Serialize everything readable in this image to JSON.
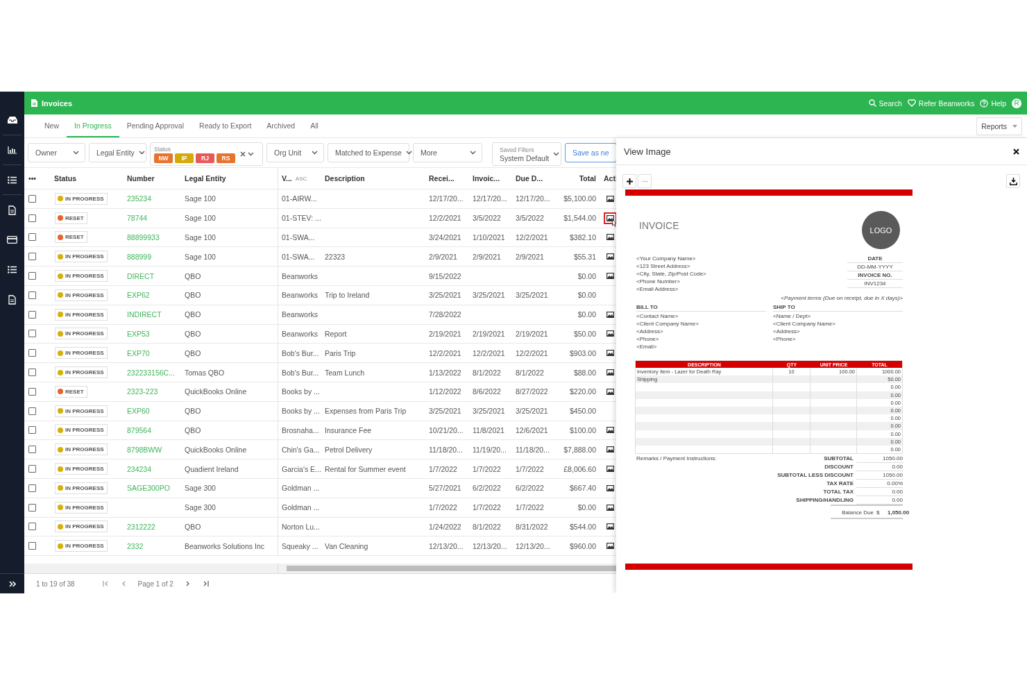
{
  "header": {
    "title": "Invoices",
    "links": [
      {
        "kind": "search",
        "label": "Search"
      },
      {
        "kind": "heart",
        "label": "Refer Beanworks"
      },
      {
        "kind": "help",
        "label": "Help"
      }
    ],
    "avatar": "R"
  },
  "tabs": [
    {
      "label": "New",
      "selected": false
    },
    {
      "label": "In Progress",
      "selected": true
    },
    {
      "label": "Pending Approval",
      "selected": false
    },
    {
      "label": "Ready to Export",
      "selected": false
    },
    {
      "label": "Archived",
      "selected": false
    },
    {
      "label": "All",
      "selected": false
    }
  ],
  "reports_button": "Reports",
  "filters": {
    "owner": "Owner",
    "legal_entity": "Legal Entity",
    "status_label": "Status",
    "status_chips": [
      {
        "label": "NW",
        "color": "#e8742c"
      },
      {
        "label": "IP",
        "color": "#d6a90a"
      },
      {
        "label": "RJ",
        "color": "#e85a5a"
      },
      {
        "label": "RS",
        "color": "#e8742c"
      }
    ],
    "org_unit": "Org Unit",
    "matched": "Matched to Expense",
    "more": "More",
    "saved_label": "Saved Filters",
    "saved_value": "System Default",
    "save_button": "Save as ne"
  },
  "table": {
    "columns": [
      "•••",
      "Status",
      "Number",
      "Legal Entity",
      "V...",
      "Description",
      "Recei...",
      "Invoic...",
      "Due D...",
      "Total",
      "Acti"
    ],
    "sort": "ASC",
    "rows": [
      {
        "checked": false,
        "status": "IN PROGRESS",
        "color": "#d6b00a",
        "number": "235234",
        "legal_entity": "Sage 100",
        "vendor": "01-AIRW...",
        "received": "12/17/20...",
        "invoice_date": "12/17/20...",
        "due_date": "12/17/20...",
        "total": "$5,100.00",
        "image": true,
        "image_focused": false
      },
      {
        "checked": false,
        "status": "RESET",
        "color": "#e8642c",
        "number": "78744",
        "legal_entity": "Sage 100",
        "vendor": "01-STEV: ...",
        "received": "12/2/2021",
        "invoice_date": "3/5/2022",
        "due_date": "3/5/2022",
        "total": "$1,544.00",
        "image": true,
        "image_focused": true
      },
      {
        "checked": false,
        "status": "RESET",
        "color": "#e8642c",
        "number": "88899933",
        "legal_entity": "Sage 100",
        "vendor": "01-SWA...",
        "received": "3/24/2021",
        "invoice_date": "1/10/2021",
        "due_date": "12/2/2021",
        "total": "$382.10",
        "image": true,
        "image_focused": false
      },
      {
        "checked": false,
        "status": "IN PROGRESS",
        "color": "#d6b00a",
        "number": "888999",
        "legal_entity": "Sage 100",
        "vendor": "01-SWA...",
        "description": "22323",
        "received": "2/9/2021",
        "invoice_date": "2/9/2021",
        "due_date": "2/9/2021",
        "total": "$55.31",
        "image": true,
        "image_focused": false
      },
      {
        "checked": false,
        "status": "IN PROGRESS",
        "color": "#d6b00a",
        "number": "DIRECT",
        "legal_entity": "QBO",
        "vendor": "Beanworks",
        "received": "9/15/2022",
        "total": "$0.00",
        "image": true,
        "image_focused": false
      },
      {
        "checked": false,
        "status": "IN PROGRESS",
        "color": "#d6b00a",
        "number": "EXP62",
        "legal_entity": "QBO",
        "vendor": "Beanworks",
        "description": "Trip to Ireland",
        "received": "3/25/2021",
        "invoice_date": "3/25/2021",
        "due_date": "3/25/2021",
        "total": "$0.00",
        "image": false
      },
      {
        "checked": false,
        "status": "IN PROGRESS",
        "color": "#d6b00a",
        "number": "INDIRECT",
        "legal_entity": "QBO",
        "vendor": "Beanworks",
        "received": "7/28/2022",
        "total": "$0.00",
        "image": true,
        "image_focused": false
      },
      {
        "checked": false,
        "status": "IN PROGRESS",
        "color": "#d6b00a",
        "number": "EXP53",
        "legal_entity": "QBO",
        "vendor": "Beanworks",
        "description": "Report",
        "received": "2/19/2021",
        "invoice_date": "2/19/2021",
        "due_date": "2/19/2021",
        "total": "$50.00",
        "image": true,
        "image_focused": false
      },
      {
        "checked": false,
        "status": "IN PROGRESS",
        "color": "#d6b00a",
        "number": "EXP70",
        "legal_entity": "QBO",
        "vendor": "Bob's Bur...",
        "description": "Paris Trip",
        "received": "12/2/2021",
        "invoice_date": "12/2/2021",
        "due_date": "12/2/2021",
        "total": "$903.00",
        "image": true,
        "image_focused": false
      },
      {
        "checked": false,
        "status": "IN PROGRESS",
        "color": "#d6b00a",
        "number": "232233156C...",
        "legal_entity": "Tomas QBO",
        "vendor": "Bob's Bur...",
        "description": "Team Lunch",
        "received": "1/13/2022",
        "invoice_date": "8/1/2022",
        "due_date": "8/1/2022",
        "total": "$88.00",
        "image": true,
        "image_focused": false
      },
      {
        "checked": false,
        "status": "RESET",
        "color": "#e8642c",
        "number": "2323-223",
        "legal_entity": "QuickBooks Online",
        "vendor": "Books by ...",
        "received": "1/12/2022",
        "invoice_date": "8/6/2022",
        "due_date": "8/27/2022",
        "total": "$220.00",
        "image": true,
        "image_focused": false
      },
      {
        "checked": false,
        "status": "IN PROGRESS",
        "color": "#d6b00a",
        "number": "EXP60",
        "legal_entity": "QBO",
        "vendor": "Books by ...",
        "description": "Expenses from Paris Trip",
        "received": "3/25/2021",
        "invoice_date": "3/25/2021",
        "due_date": "3/25/2021",
        "total": "$450.00",
        "image": false
      },
      {
        "checked": false,
        "status": "IN PROGRESS",
        "color": "#d6b00a",
        "number": "879564",
        "legal_entity": "QBO",
        "vendor": "Brosnaha...",
        "description": "Insurance Fee",
        "received": "10/21/20...",
        "invoice_date": "11/8/2021",
        "due_date": "12/6/2021",
        "total": "$100.00",
        "image": true,
        "image_focused": false
      },
      {
        "checked": false,
        "status": "IN PROGRESS",
        "color": "#d6b00a",
        "number": "8798BWW",
        "legal_entity": "QuickBooks Online",
        "vendor": "Chin's Ga...",
        "description": "Petrol Delivery",
        "received": "11/18/20...",
        "invoice_date": "11/19/20...",
        "due_date": "11/18/20...",
        "total": "$7,888.00",
        "image": true,
        "image_focused": false
      },
      {
        "checked": false,
        "status": "IN PROGRESS",
        "color": "#d6b00a",
        "number": "234234",
        "legal_entity": "Quadient Ireland",
        "vendor": "Garcia's E...",
        "description": "Rental for Summer event",
        "received": "1/7/2022",
        "invoice_date": "1/7/2022",
        "due_date": "1/7/2022",
        "total": "£8,006.60",
        "image": true,
        "image_focused": false
      },
      {
        "checked": false,
        "status": "IN PROGRESS",
        "color": "#d6b00a",
        "number": "SAGE300PO",
        "legal_entity": "Sage 300",
        "vendor": "Goldman ...",
        "received": "5/27/2021",
        "invoice_date": "6/2/2022",
        "due_date": "6/2/2022",
        "total": "$667.40",
        "image": true,
        "image_focused": false
      },
      {
        "checked": false,
        "status": "IN PROGRESS",
        "color": "#d6b00a",
        "legal_entity": "Sage 300",
        "vendor": "Goldman ...",
        "received": "1/7/2022",
        "invoice_date": "1/7/2022",
        "due_date": "1/7/2022",
        "total": "$0.00",
        "image": true,
        "image_focused": false
      },
      {
        "checked": false,
        "status": "IN PROGRESS",
        "color": "#d6b00a",
        "number": "2312222",
        "legal_entity": "QBO",
        "vendor": "Norton Lu...",
        "received": "1/24/2022",
        "invoice_date": "8/1/2022",
        "due_date": "8/31/2022",
        "total": "$544.00",
        "image": true,
        "image_focused": false
      },
      {
        "checked": false,
        "status": "IN PROGRESS",
        "color": "#d6b00a",
        "number": "2332",
        "legal_entity": "Beanworks Solutions Inc",
        "vendor": "Squeaky ...",
        "description": "Van Cleaning",
        "received": "12/13/20...",
        "invoice_date": "12/13/20...",
        "due_date": "12/13/20...",
        "total": "$960.00",
        "image": true,
        "image_focused": false
      }
    ]
  },
  "pagination": {
    "range": "1 to 19 of 38",
    "page": "Page 1 of 2"
  },
  "viewer": {
    "title": "View Image",
    "invoice": {
      "title": "INVOICE",
      "logo": "LOGO",
      "sender_lines": [
        "<Your Company Name>",
        "<123 Street Address>",
        "<City, State, Zip/Post Code>",
        "<Phone Number>",
        "<Email Address>"
      ],
      "meta": [
        {
          "label": "DATE",
          "value": "DD-MM-YYYY"
        },
        {
          "label": "INVOICE NO.",
          "value": "INV1234"
        }
      ],
      "payment_terms": "<Payment terms (Due on receipt, due in X days)>",
      "bill_to": {
        "heading": "BILL TO",
        "lines": [
          "<Contact Name>",
          "<Client Company Name>",
          "<Address>",
          "<Phone>",
          "<Email>"
        ]
      },
      "ship_to": {
        "heading": "SHIP TO",
        "lines": [
          "<Name / Dept>",
          "<Client Company Name>",
          "<Address>",
          "<Phone>"
        ]
      },
      "columns": [
        "DESCRIPTION",
        "QTY",
        "UNIT PRICE",
        "TOTAL"
      ],
      "items": [
        {
          "description": "Inventory Item - Lazer for Death Ray",
          "qty": "10",
          "unit_price": "100.00",
          "total": "1000.00"
        },
        {
          "description": "Shipping",
          "total": "50.00"
        },
        {
          "total": "0.00"
        },
        {
          "total": "0.00"
        },
        {
          "total": "0.00"
        },
        {
          "total": "0.00"
        },
        {
          "total": "0.00"
        },
        {
          "total": "0.00"
        },
        {
          "total": "0.00"
        },
        {
          "total": "0.00"
        },
        {
          "total": "0.00"
        }
      ],
      "remarks": "Remarks / Payment Instructions:",
      "summary": [
        {
          "label": "SUBTOTAL",
          "value": "1050.00"
        },
        {
          "label": "DISCOUNT",
          "value": "0.00"
        },
        {
          "label": "SUBTOTAL LESS DISCOUNT",
          "value": "1050.00"
        },
        {
          "label": "TAX RATE",
          "value": "0.00%"
        },
        {
          "label": "TOTAL TAX",
          "value": "0.00"
        },
        {
          "label": "SHIPPING/HANDLING",
          "value": "0.00"
        }
      ],
      "balance": {
        "label": "Balance Due",
        "currency": "$",
        "value": "1,050.00"
      }
    }
  }
}
